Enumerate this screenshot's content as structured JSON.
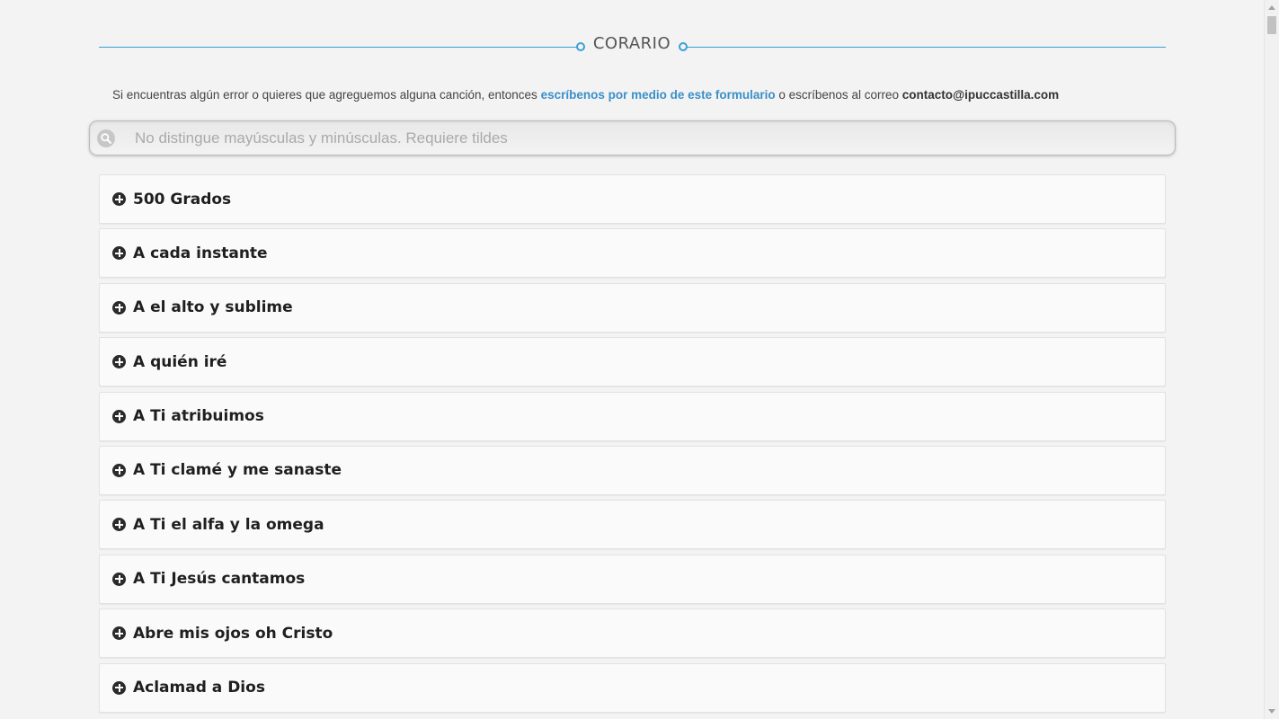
{
  "header": {
    "title": "CORARIO"
  },
  "intro": {
    "text_before": "Si encuentras algún error o quieres que agreguemos alguna canción, entonces ",
    "link_text": "escríbenos por medio de este formulario",
    "text_middle": " o escríbenos al correo ",
    "email": "contacto@ipuccastilla.com"
  },
  "search": {
    "placeholder": "No distingue mayúsculas y minúsculas. Requiere tildes",
    "value": ""
  },
  "songs": [
    {
      "title": "500 Grados"
    },
    {
      "title": "A cada instante"
    },
    {
      "title": "A el alto y sublime"
    },
    {
      "title": "A quién iré"
    },
    {
      "title": "A Ti atribuimos"
    },
    {
      "title": "A Ti clamé y me sanaste"
    },
    {
      "title": "A Ti el alfa y la omega"
    },
    {
      "title": "A Ti Jesús cantamos"
    },
    {
      "title": "Abre mis ojos oh Cristo"
    },
    {
      "title": "Aclamad a Dios"
    }
  ],
  "colors": {
    "accent": "#3aa0d6",
    "link": "#3a8fca",
    "background": "#f3f3f3"
  },
  "icons": {
    "search": "search-icon",
    "expand": "plus-circle-icon"
  }
}
